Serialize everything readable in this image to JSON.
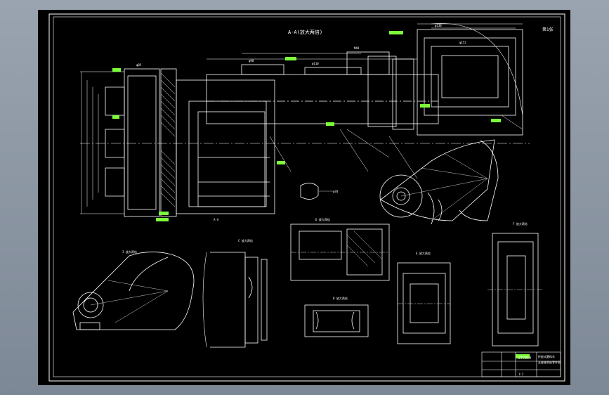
{
  "app": {
    "background_color": "#8a95a3",
    "paper_color": "#000000",
    "line_color": "#ffffff",
    "tag_color": "#7cff3a",
    "dim_color": "#e8e8e8"
  },
  "drawing": {
    "main_view_label": "A-A(放大两倍)",
    "sheet_number": "第1张",
    "title_block": {
      "drawing_code": "ZTC050",
      "title_line1": "托板式磨料车",
      "title_line2": "支座轴承座零件图",
      "scale_text": "1:2"
    },
    "section_labels": [
      "I 放大两倍",
      "C 放大两倍",
      "D 放大两倍",
      "B 放大两倍",
      "E 放大两倍",
      "F 放大两倍"
    ]
  }
}
